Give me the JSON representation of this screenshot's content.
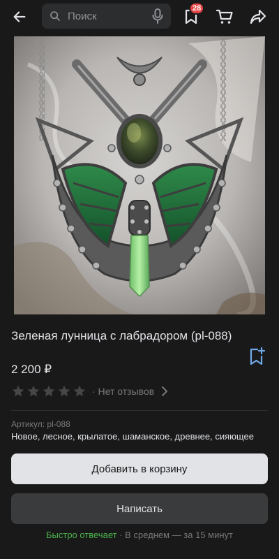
{
  "header": {
    "search_placeholder": "Поиск",
    "favorites_badge": "28"
  },
  "product": {
    "title": "Зеленая лунница с лабрадором (pl-088)",
    "price": "2 200 ₽",
    "rating_stars": 0,
    "rating_max": 5,
    "reviews_text": "· Нет отзывов",
    "article": "Артикул: pl-088",
    "tags": "Новое, лесное, крылатое, шаманское, древнее, сияющее"
  },
  "actions": {
    "add_to_cart": "Добавить в корзину",
    "write": "Написать"
  },
  "seller_response": {
    "fast": "Быстро отвечает",
    "average": "· В среднем — за 15 минут"
  },
  "colors": {
    "background": "#19191a",
    "accent": "#71aaeb",
    "badge": "#e64646",
    "fast_response": "#4bb34b",
    "primary_button": "#e1e3e6",
    "secondary_button": "#3a3b3c"
  },
  "icons": {
    "back": "arrow-left-icon",
    "search": "search-icon",
    "mic": "mic-icon",
    "favorites": "bookmark-icon",
    "cart": "cart-icon",
    "share": "share-icon",
    "add_to_favorites": "bookmark-plus-icon",
    "star": "star-icon",
    "chevron": "chevron-right-icon"
  }
}
